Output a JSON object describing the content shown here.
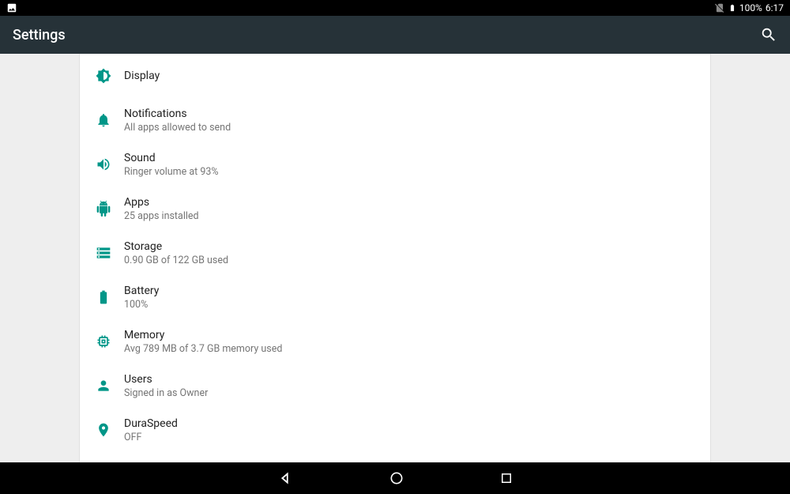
{
  "status": {
    "battery_pct": "100%",
    "clock": "6:17"
  },
  "app_bar": {
    "title": "Settings"
  },
  "items": [
    {
      "icon": "display",
      "title": "Display",
      "sub": ""
    },
    {
      "icon": "notifications",
      "title": "Notifications",
      "sub": "All apps allowed to send"
    },
    {
      "icon": "sound",
      "title": "Sound",
      "sub": "Ringer volume at 93%"
    },
    {
      "icon": "apps",
      "title": "Apps",
      "sub": "25 apps installed"
    },
    {
      "icon": "storage",
      "title": "Storage",
      "sub": "0.90 GB of 122 GB used"
    },
    {
      "icon": "battery",
      "title": "Battery",
      "sub": "100%"
    },
    {
      "icon": "memory",
      "title": "Memory",
      "sub": "Avg 789 MB of 3.7 GB memory used"
    },
    {
      "icon": "users",
      "title": "Users",
      "sub": "Signed in as Owner"
    },
    {
      "icon": "duraspeed",
      "title": "DuraSpeed",
      "sub": "OFF"
    }
  ]
}
